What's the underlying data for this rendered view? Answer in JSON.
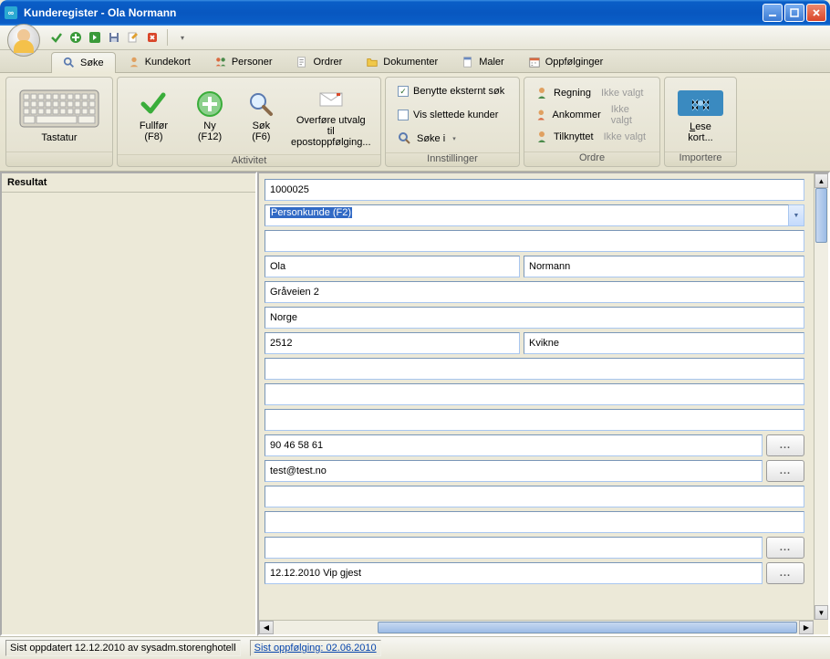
{
  "window": {
    "title": "Kunderegister - Ola Normann"
  },
  "toolbar": {
    "icons": [
      "check-icon",
      "plus-icon",
      "forward-icon",
      "save-icon",
      "edit-icon",
      "delete-icon"
    ]
  },
  "tabs": [
    {
      "label": "Søke",
      "icon": "search-icon"
    },
    {
      "label": "Kundekort",
      "icon": "person-icon"
    },
    {
      "label": "Personer",
      "icon": "people-icon"
    },
    {
      "label": "Ordrer",
      "icon": "order-icon"
    },
    {
      "label": "Dokumenter",
      "icon": "folder-icon"
    },
    {
      "label": "Maler",
      "icon": "template-icon"
    },
    {
      "label": "Oppfølginger",
      "icon": "calendar-icon"
    }
  ],
  "ribbon": {
    "g1": {
      "caption": "Tastatur"
    },
    "g2": {
      "caption": "Aktivitet",
      "btn1": "Fullfør (F8)",
      "btn2": "Ny (F12)",
      "btn3": "Søk (F6)",
      "btn4a": "Overføre utvalg til",
      "btn4b": "epostoppfølging..."
    },
    "g3": {
      "caption": "Innstillinger",
      "chk1": "Benytte eksternt søk",
      "chk2": "Vis slettede kunder",
      "btn": "Søke i"
    },
    "g4": {
      "caption": "Ordre",
      "row1": "Regning",
      "h1": "Ikke valgt",
      "row2": "Ankommer",
      "h2": "Ikke valgt",
      "row3": "Tilknyttet",
      "h3": "Ikke valgt"
    },
    "g5": {
      "caption": "Importere",
      "btn": "Lese kort..."
    }
  },
  "left": {
    "header": "Resultat"
  },
  "form": {
    "id": "1000025",
    "type": "Personkunde (F2)",
    "fname": "Ola",
    "lname": "Normann",
    "addr": "Gråveien 2",
    "country": "Norge",
    "zip": "2512",
    "city": "Kvikne",
    "phone": "90 46 58 61",
    "email": "test@test.no",
    "note": "12.12.2010 Vip gjest",
    "blank": ""
  },
  "status": {
    "text": "Sist oppdatert 12.12.2010 av sysadm.storenghotell",
    "link": "Sist oppfølging: 02.06.2010"
  },
  "colors": {
    "accent": "#316ac5"
  }
}
